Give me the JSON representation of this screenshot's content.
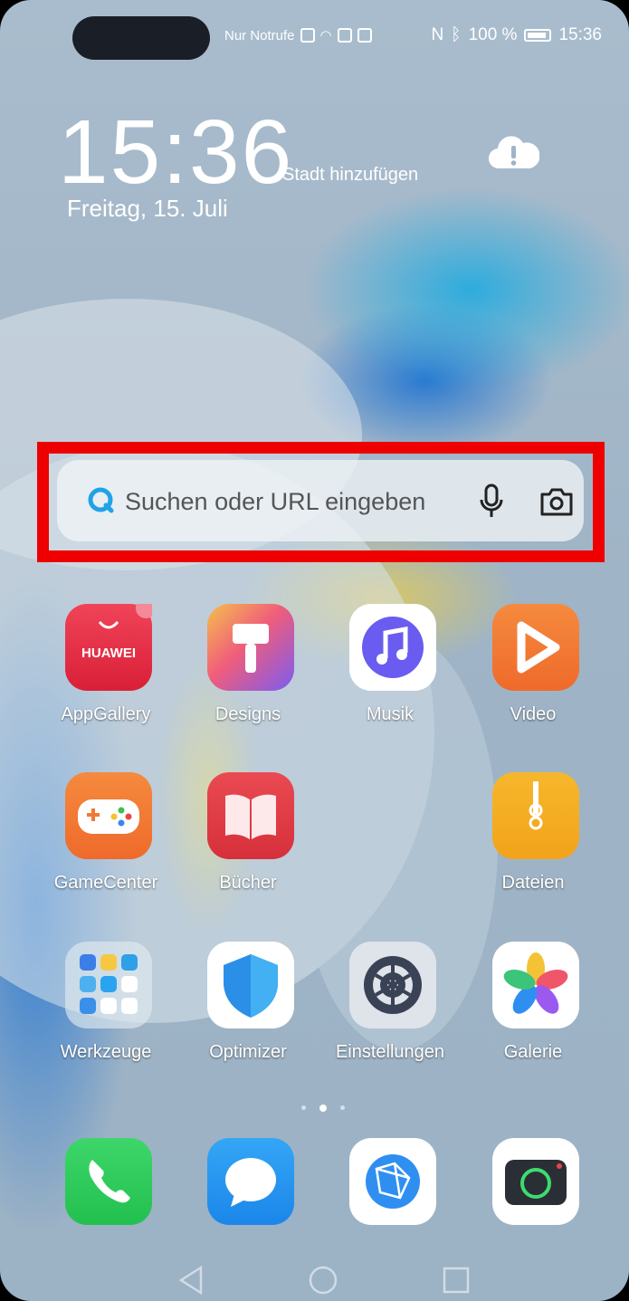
{
  "status_bar": {
    "carrier": "Nur Notrufe",
    "battery": "100 %",
    "time": "15:36"
  },
  "clock_widget": {
    "time": "15:36",
    "add_city": "Stadt hinzufügen",
    "date": "Freitag, 15. Juli"
  },
  "search": {
    "placeholder": "Suchen oder URL eingeben"
  },
  "apps": [
    {
      "label": "AppGallery",
      "icon": "huawei-appgallery-icon",
      "badge_text": "HUAWEI"
    },
    {
      "label": "Designs",
      "icon": "designs-icon"
    },
    {
      "label": "Musik",
      "icon": "music-icon"
    },
    {
      "label": "Video",
      "icon": "video-icon"
    },
    {
      "label": "GameCenter",
      "icon": "gamecenter-icon"
    },
    {
      "label": "Bücher",
      "icon": "books-icon"
    },
    {
      "label": "Dateien",
      "icon": "files-icon"
    },
    {
      "label": "Werkzeuge",
      "icon": "tools-folder-icon"
    },
    {
      "label": "Optimizer",
      "icon": "optimizer-icon"
    },
    {
      "label": "Einstellungen",
      "icon": "settings-icon"
    },
    {
      "label": "Galerie",
      "icon": "gallery-icon"
    }
  ],
  "dock": [
    {
      "icon": "phone-icon"
    },
    {
      "icon": "messages-icon"
    },
    {
      "icon": "browser-icon"
    },
    {
      "icon": "camera-icon"
    }
  ],
  "page_indicator": {
    "pages": 3,
    "active": 2
  },
  "colors": {
    "highlight": "#ee0000"
  }
}
